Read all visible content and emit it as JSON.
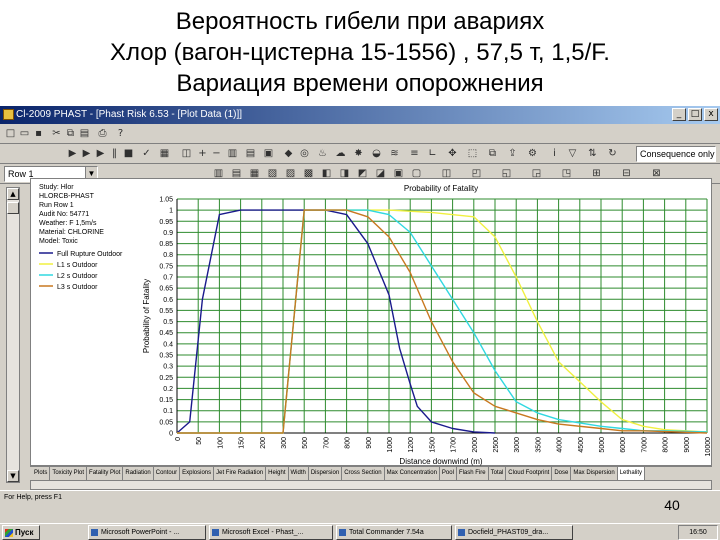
{
  "slide": {
    "title_line1": "Вероятность гибели при авариях",
    "title_line2": "Хлор (вагон-цистерна 15-1556) , 57,5 т, 1,5/F.",
    "title_line3": "Вариация времени опорожнения",
    "page_number": "40"
  },
  "window": {
    "title": "Cl-2009 PHAST - [Phast Risk 6.53 - [Plot Data (1)]]",
    "min_label": "_",
    "max_label": "□",
    "close_label": "x"
  },
  "toolbar": {
    "row_combo": "Row 1",
    "consequence_combo": "Consequence only"
  },
  "chart_data": {
    "type": "line",
    "title": "Probability of Fatality",
    "xlabel": "Distance downwind (m)",
    "ylabel": "Probability of Fatality",
    "ylim": [
      0,
      1.05
    ],
    "y_ticks": [
      0,
      0.05,
      0.1,
      0.15,
      0.2,
      0.25,
      0.3,
      0.35,
      0.4,
      0.45,
      0.5,
      0.55,
      0.6,
      0.65,
      0.7,
      0.75,
      0.8,
      0.85,
      0.9,
      0.95,
      1,
      1.05
    ],
    "x_ticks": [
      "0",
      "50",
      "100",
      "150",
      "200",
      "300",
      "500",
      "700",
      "800",
      "900",
      "1000",
      "1200",
      "1500",
      "1700",
      "2000",
      "2500",
      "3000",
      "3500",
      "4000",
      "4500",
      "5000",
      "6000",
      "7000",
      "8000",
      "9000",
      "10000"
    ],
    "info_lines": [
      "Study: Hlor",
      "HLORCB-PHAST",
      "Run Row 1",
      "Audit No: 54771",
      "Weather: F 1,5m/s",
      "Material: CHLORINE",
      "Model: Toxic"
    ],
    "series": [
      {
        "name": "Full Rupture Outdoor",
        "color": "#1a1a8c",
        "x": [
          0,
          30,
          60,
          100,
          150,
          200,
          300,
          500,
          700,
          800,
          900,
          1000,
          1100,
          1200,
          1300,
          1500,
          1700,
          2000,
          2500
        ],
        "y": [
          0,
          0.05,
          0.6,
          0.98,
          1,
          1,
          1,
          1,
          1,
          0.98,
          0.85,
          0.62,
          0.38,
          0.22,
          0.12,
          0.05,
          0.02,
          0.005,
          0
        ]
      },
      {
        "name": "L1 s Outdoor",
        "color": "#f0f040",
        "x": [
          0,
          300,
          500,
          1000,
          1500,
          2000,
          2500,
          3000,
          3500,
          4000,
          5000,
          6000,
          7000,
          8000,
          10000
        ],
        "y": [
          0,
          0,
          1,
          1,
          0.99,
          0.97,
          0.88,
          0.7,
          0.5,
          0.32,
          0.14,
          0.06,
          0.03,
          0.015,
          0.005
        ]
      },
      {
        "name": "L2 s Outdoor",
        "color": "#30d8e0",
        "x": [
          0,
          300,
          500,
          900,
          1000,
          1200,
          1500,
          1700,
          2000,
          2500,
          3000,
          3500,
          4000,
          5000,
          6000,
          7000,
          8000,
          10000
        ],
        "y": [
          0,
          0,
          1,
          1,
          0.98,
          0.9,
          0.75,
          0.6,
          0.45,
          0.28,
          0.14,
          0.09,
          0.06,
          0.03,
          0.02,
          0.01,
          0.01,
          0.005
        ]
      },
      {
        "name": "L3 s Outdoor",
        "color": "#c87820",
        "x": [
          0,
          300,
          500,
          800,
          900,
          1000,
          1200,
          1500,
          1700,
          2000,
          2500,
          3000,
          3500,
          4000,
          5000,
          6000,
          7000,
          10000
        ],
        "y": [
          0,
          0,
          1,
          1,
          0.97,
          0.88,
          0.72,
          0.5,
          0.32,
          0.18,
          0.12,
          0.09,
          0.06,
          0.04,
          0.02,
          0.01,
          0.01,
          0
        ]
      }
    ],
    "legend_position": "top-left",
    "grid": true
  },
  "tabs": [
    "Plots",
    "Toxicity Plot",
    "Fatality Plot",
    "Radiation",
    "Contour",
    "Explosions",
    "Jet Fire Radiation",
    "Height",
    "Width",
    "Dispersion",
    "Cross Section",
    "Max Concentration",
    "Pool",
    "Flash Fire",
    "Total",
    "Cloud Footprint",
    "Dose",
    "Max Dispersion",
    "Lethality"
  ],
  "status": {
    "text": "For Help, press F1"
  },
  "taskbar": {
    "start": "Пуск",
    "items": [
      "Microsoft PowerPoint - ...",
      "Microsoft Excel - Phast_...",
      "Total Commander 7.54a",
      "Docfield_PHAST09_dra..."
    ],
    "tray": "16:50"
  }
}
